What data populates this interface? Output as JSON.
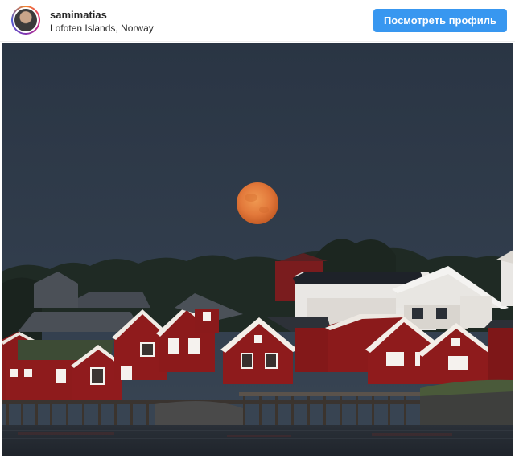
{
  "post": {
    "username": "samimatias",
    "location": "Lofoten Islands, Norway",
    "view_profile_label": "Посмотреть профиль"
  },
  "colors": {
    "button": "#3897f0",
    "sky": "#2e3947",
    "moon": "#e0743a",
    "houses": "#8e1b1c"
  },
  "icons": {
    "avatar": "user-avatar"
  }
}
